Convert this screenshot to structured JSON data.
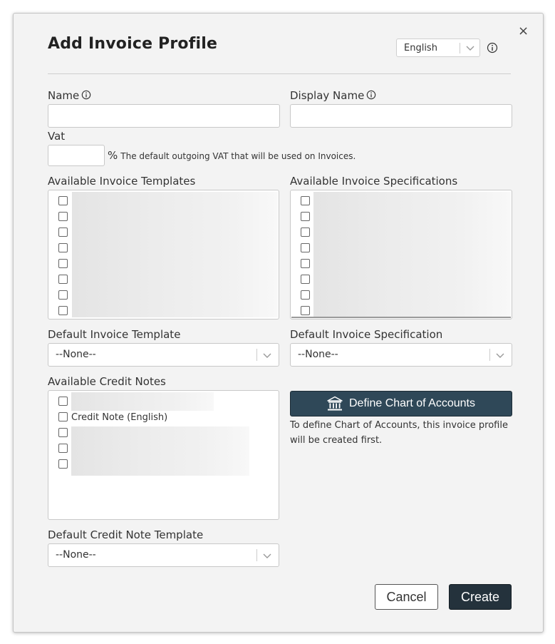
{
  "dialog": {
    "title": "Add Invoice Profile",
    "close_glyph": "×",
    "language": {
      "selected": "English",
      "icon": "chevron-down-icon"
    }
  },
  "form": {
    "name_label": "Name",
    "display_name_label": "Display Name",
    "vat_label": "Vat",
    "vat_value": "",
    "vat_percent_symbol": "%",
    "vat_note": "The default outgoing VAT that will be used on Invoices.",
    "available_templates_label": "Available Invoice Templates",
    "available_specs_label": "Available Invoice Specifications",
    "default_template_label": "Default Invoice Template",
    "default_template_value": "--None--",
    "default_spec_label": "Default Invoice Specification",
    "default_spec_value": "--None--",
    "available_credit_notes_label": "Available Credit Notes",
    "credit_notes": [
      {
        "label": ""
      },
      {
        "label": "Credit Note (English)"
      },
      {
        "label": ""
      },
      {
        "label": ""
      },
      {
        "label": ""
      }
    ],
    "default_credit_note_label": "Default Credit Note Template",
    "default_credit_note_value": "--None--"
  },
  "chart_of_accounts": {
    "button_label": "Define Chart of Accounts",
    "icon": "bank-icon",
    "help_text": "To define Chart of Accounts, this invoice profile will be created first."
  },
  "footer": {
    "cancel_label": "Cancel",
    "create_label": "Create"
  },
  "colors": {
    "dialog_bg": "#f3f3f3",
    "primary_button": "#24323c",
    "coa_button": "#2f4858"
  }
}
